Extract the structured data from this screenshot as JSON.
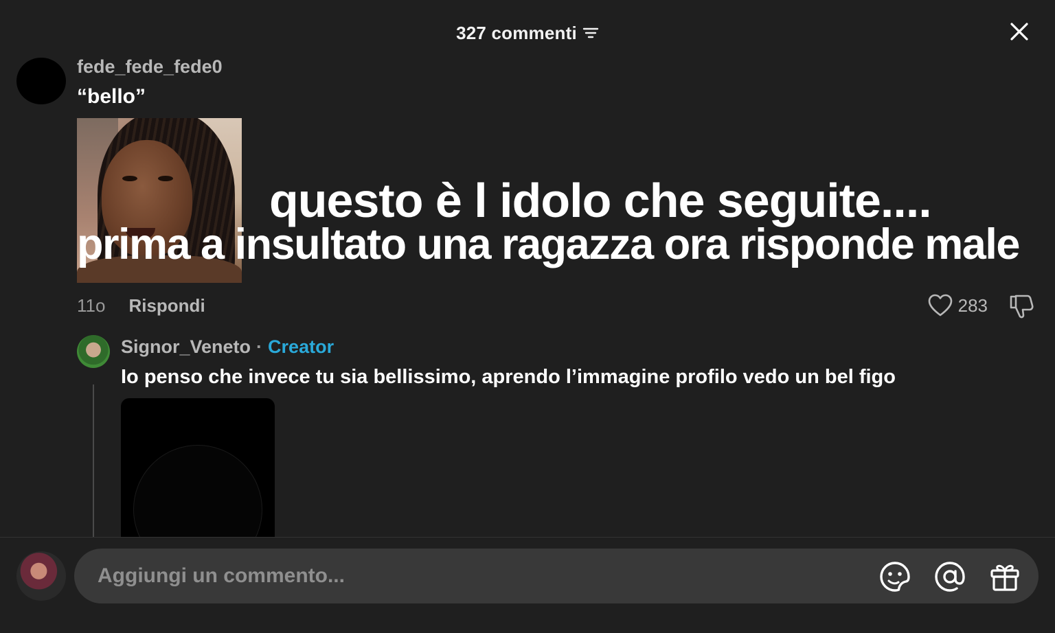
{
  "header": {
    "title": "327 commenti"
  },
  "comment": {
    "username": "fede_fede_fede0",
    "text": "“bello”",
    "meme_line1": "questo è l idolo che seguite....",
    "meme_line2": "prima a insultato una ragazza ora risponde male",
    "time": "11o",
    "reply_label": "Rispondi",
    "like_count": "283"
  },
  "reply": {
    "username": "Signor_Veneto",
    "separator": "·",
    "badge": "Creator",
    "text": "Io penso che invece tu sia bellissimo, aprendo l’immagine profilo vedo un bel figo"
  },
  "input": {
    "placeholder": "Aggiungi un commento..."
  },
  "colors": {
    "background": "#1f1f1f",
    "creator_accent": "#2aa9d9",
    "input_bg": "#393939"
  },
  "icons": [
    "sort-icon",
    "close-icon",
    "heart-icon",
    "dislike-icon",
    "sticker-icon",
    "mention-icon",
    "gift-icon"
  ]
}
